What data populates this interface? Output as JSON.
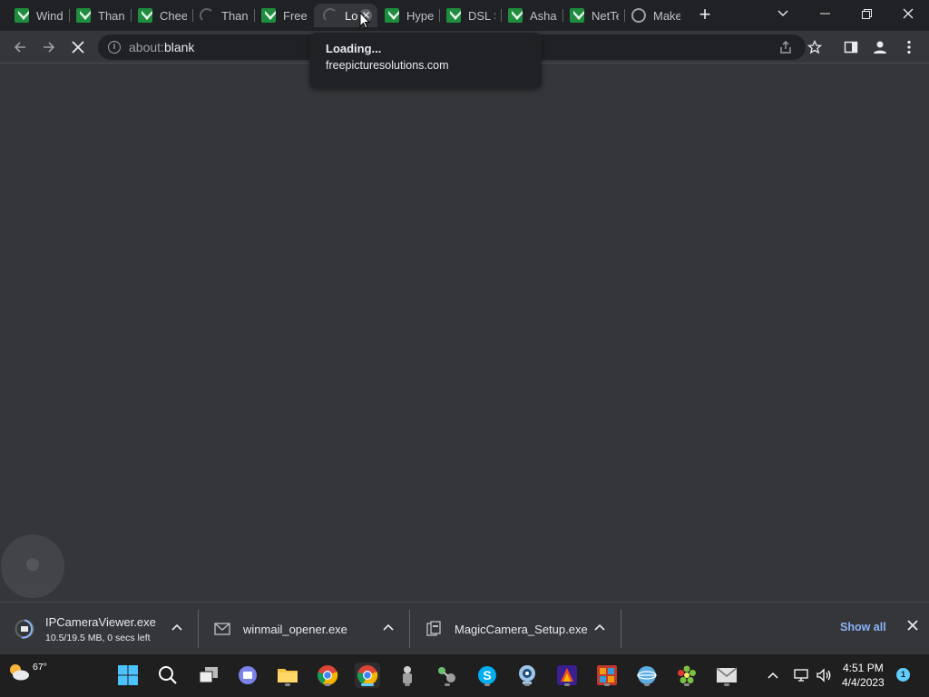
{
  "browser": {
    "tabs": [
      {
        "title": "Wind",
        "favicon": "green-shield-icon"
      },
      {
        "title": "Than",
        "favicon": "green-shield-icon"
      },
      {
        "title": "Chee",
        "favicon": "green-shield-icon"
      },
      {
        "title": "Than",
        "favicon": "loading-spinner-icon"
      },
      {
        "title": "Free",
        "favicon": "green-shield-icon"
      },
      {
        "title": "Lo",
        "favicon": "loading-spinner-icon",
        "active": true
      },
      {
        "title": "Hype",
        "favicon": "green-shield-icon"
      },
      {
        "title": "DSL S",
        "favicon": "green-shield-icon"
      },
      {
        "title": "Asha",
        "favicon": "green-shield-icon"
      },
      {
        "title": "NetTe",
        "favicon": "green-shield-icon"
      },
      {
        "title": "Make",
        "favicon": "globe-icon"
      }
    ],
    "address": {
      "scheme": "about:",
      "path": "blank"
    },
    "hovercard": {
      "title": "Loading...",
      "domain": "freepicturesolutions.com"
    }
  },
  "downloads": {
    "items": [
      {
        "name": "IPCameraViewer.exe",
        "status": "10.5/19.5 MB, 0 secs left"
      },
      {
        "name": "winmail_opener.exe"
      },
      {
        "name": "MagicCamera_Setup.exe"
      }
    ],
    "show_all": "Show all"
  },
  "taskbar": {
    "weather_temp": "67°",
    "time": "4:51 PM",
    "date": "4/4/2023",
    "notifications": "1"
  },
  "colors": {
    "tabstrip": "#202124",
    "toolbar": "#35363a",
    "accent": "#8ab4f8",
    "shield_green": "#1e8e3e",
    "taskbar": "#1f1f1f"
  }
}
